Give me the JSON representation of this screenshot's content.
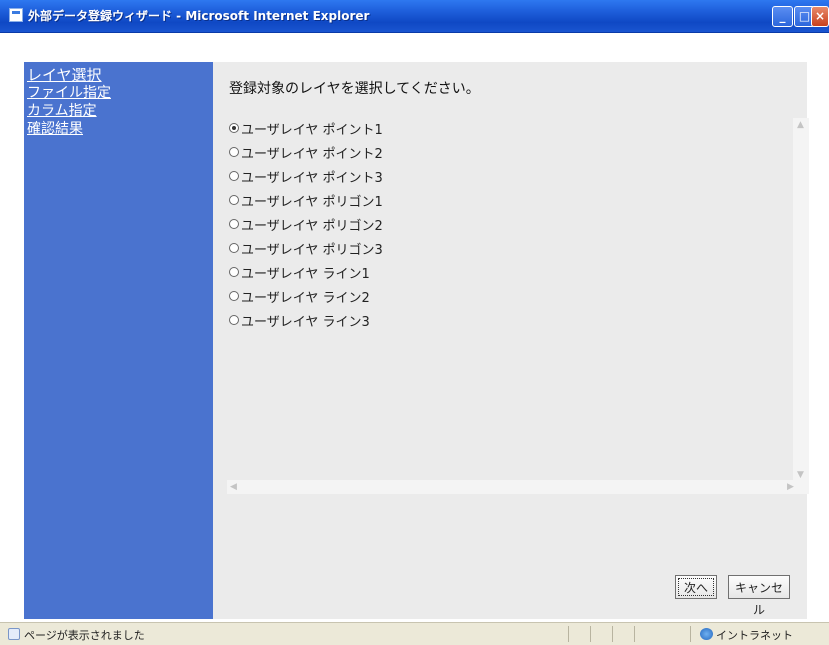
{
  "window": {
    "title": "外部データ登録ウィザード - Microsoft Internet Explorer",
    "minimize_symbol": "_",
    "maximize_symbol": "□",
    "close_symbol": "×"
  },
  "sidebar": {
    "items": [
      {
        "label": "レイヤ選択"
      },
      {
        "label": "ファイル指定"
      },
      {
        "label": "カラム指定"
      },
      {
        "label": "確認結果"
      }
    ]
  },
  "main": {
    "instruction": "登録対象のレイヤを選択してください。",
    "options": [
      {
        "label": "ユーザレイヤ ポイント1",
        "checked": true
      },
      {
        "label": "ユーザレイヤ ポイント2",
        "checked": false
      },
      {
        "label": "ユーザレイヤ ポイント3",
        "checked": false
      },
      {
        "label": "ユーザレイヤ ポリゴン1",
        "checked": false
      },
      {
        "label": "ユーザレイヤ ポリゴン2",
        "checked": false
      },
      {
        "label": "ユーザレイヤ ポリゴン3",
        "checked": false
      },
      {
        "label": "ユーザレイヤ ライン1",
        "checked": false
      },
      {
        "label": "ユーザレイヤ ライン2",
        "checked": false
      },
      {
        "label": "ユーザレイヤ ライン3",
        "checked": false
      }
    ]
  },
  "buttons": {
    "next_label": "次へ",
    "cancel_label": "キャンセル"
  },
  "statusbar": {
    "text": "ページが表示されました",
    "zone": "イントラネット"
  },
  "colors": {
    "sidebar_bg": "#4a73cf",
    "titlebar": "#1c5bd8",
    "content_bg": "#ebebeb"
  }
}
